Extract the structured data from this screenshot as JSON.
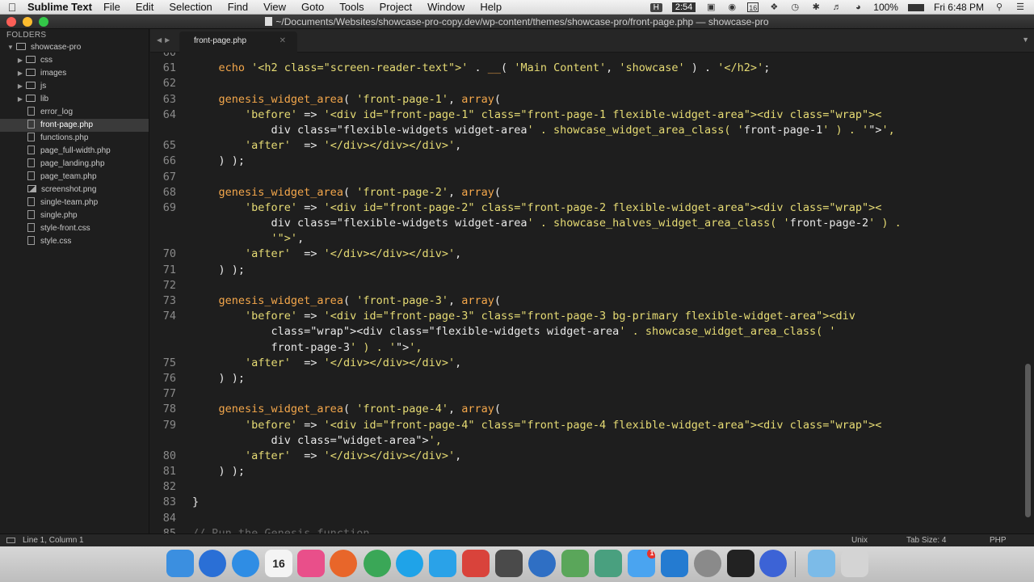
{
  "menubar": {
    "app_name": "Sublime Text",
    "menus": [
      "File",
      "Edit",
      "Selection",
      "Find",
      "View",
      "Goto",
      "Tools",
      "Project",
      "Window",
      "Help"
    ],
    "indicator_h": "H",
    "timer": "2:54",
    "calendar_day": "16",
    "battery": "100%",
    "clock": "Fri 6:48 PM"
  },
  "window": {
    "title": "~/Documents/Websites/showcase-pro-copy.dev/wp-content/themes/showcase-pro/front-page.php — showcase-pro"
  },
  "sidebar": {
    "header": "FOLDERS",
    "root": "showcase-pro",
    "folders": [
      "css",
      "images",
      "js",
      "lib"
    ],
    "files": [
      "error_log",
      "front-page.php",
      "functions.php",
      "page_full-width.php",
      "page_landing.php",
      "page_team.php",
      "screenshot.png",
      "single-team.php",
      "single.php",
      "style-front.css",
      "style.css"
    ],
    "selected": "front-page.php"
  },
  "tab": {
    "label": "front-page.php"
  },
  "editor": {
    "lines": [
      {
        "n": "60",
        "t": ""
      },
      {
        "n": "61",
        "t": "    echo '<h2 class=\"screen-reader-text\">' . __( 'Main Content', 'showcase' ) . '</h2>';"
      },
      {
        "n": "62",
        "t": ""
      },
      {
        "n": "63",
        "t": "    genesis_widget_area( 'front-page-1', array("
      },
      {
        "n": "64",
        "t": "        'before' => '<div id=\"front-page-1\" class=\"front-page-1 flexible-widget-area\"><div class=\"wrap\"><"
      },
      {
        "n": "",
        "t": "            div class=\"flexible-widgets widget-area' . showcase_widget_area_class( 'front-page-1' ) . '\">',"
      },
      {
        "n": "65",
        "t": "        'after'  => '</div></div></div>',"
      },
      {
        "n": "66",
        "t": "    ) );"
      },
      {
        "n": "67",
        "t": ""
      },
      {
        "n": "68",
        "t": "    genesis_widget_area( 'front-page-2', array("
      },
      {
        "n": "69",
        "t": "        'before' => '<div id=\"front-page-2\" class=\"front-page-2 flexible-widget-area\"><div class=\"wrap\"><"
      },
      {
        "n": "",
        "t": "            div class=\"flexible-widgets widget-area' . showcase_halves_widget_area_class( 'front-page-2' ) ."
      },
      {
        "n": "",
        "t": "            '\">',"
      },
      {
        "n": "70",
        "t": "        'after'  => '</div></div></div>',"
      },
      {
        "n": "71",
        "t": "    ) );"
      },
      {
        "n": "72",
        "t": ""
      },
      {
        "n": "73",
        "t": "    genesis_widget_area( 'front-page-3', array("
      },
      {
        "n": "74",
        "t": "        'before' => '<div id=\"front-page-3\" class=\"front-page-3 bg-primary flexible-widget-area\"><div"
      },
      {
        "n": "",
        "t": "            class=\"wrap\"><div class=\"flexible-widgets widget-area' . showcase_widget_area_class( '"
      },
      {
        "n": "",
        "t": "            front-page-3' ) . '\">',"
      },
      {
        "n": "75",
        "t": "        'after'  => '</div></div></div>',"
      },
      {
        "n": "76",
        "t": "    ) );"
      },
      {
        "n": "77",
        "t": ""
      },
      {
        "n": "78",
        "t": "    genesis_widget_area( 'front-page-4', array("
      },
      {
        "n": "79",
        "t": "        'before' => '<div id=\"front-page-4\" class=\"front-page-4 flexible-widget-area\"><div class=\"wrap\"><"
      },
      {
        "n": "",
        "t": "            div class=\"widget-area\">',"
      },
      {
        "n": "80",
        "t": "        'after'  => '</div></div></div>',"
      },
      {
        "n": "81",
        "t": "    ) );"
      },
      {
        "n": "82",
        "t": ""
      },
      {
        "n": "83",
        "t": "}"
      },
      {
        "n": "84",
        "t": ""
      },
      {
        "n": "85",
        "t": "// Run the Genesis function"
      }
    ]
  },
  "statusbar": {
    "position": "Line 1, Column 1",
    "line_endings": "Unix",
    "tab_size": "Tab Size: 4",
    "syntax": "PHP"
  },
  "dock": {
    "apps": [
      {
        "name": "Finder",
        "color": "#3b8fe0"
      },
      {
        "name": "Siri",
        "color": "#2a6fd6"
      },
      {
        "name": "Safari",
        "color": "#2f8de4"
      },
      {
        "name": "Calendar",
        "color": "#f4f4f4"
      },
      {
        "name": "iTunes",
        "color": "#e94f8a"
      },
      {
        "name": "Firefox",
        "color": "#e8662a"
      },
      {
        "name": "Chrome",
        "color": "#3aa757"
      },
      {
        "name": "Skype",
        "color": "#1fa3e8"
      },
      {
        "name": "Twitter",
        "color": "#2aa2e8"
      },
      {
        "name": "Slides",
        "color": "#d9433b"
      },
      {
        "name": "Sublime Text",
        "color": "#4a4a4a"
      },
      {
        "name": "1Password",
        "color": "#2f6fc4"
      },
      {
        "name": "Cloud App",
        "color": "#5aa65a"
      },
      {
        "name": "Elephant",
        "color": "#49a07f"
      },
      {
        "name": "Messages",
        "color": "#4aa4f0"
      },
      {
        "name": "Spark",
        "color": "#247bd1"
      },
      {
        "name": "Stacks",
        "color": "#8a8a8a"
      },
      {
        "name": "Terminal",
        "color": "#222222"
      },
      {
        "name": "Discord",
        "color": "#3c63d6"
      },
      {
        "name": "Downloads Folder",
        "color": "#7cbbe8"
      },
      {
        "name": "Trash",
        "color": "#d4d4d4"
      }
    ],
    "calendar_label": "16",
    "messages_badge": "1"
  }
}
